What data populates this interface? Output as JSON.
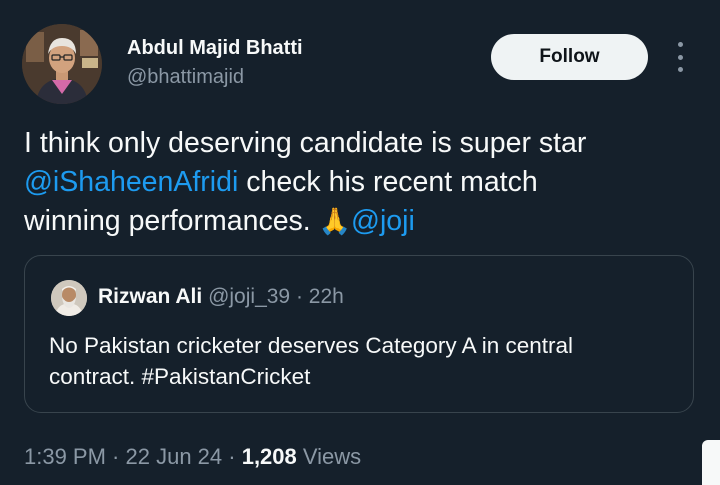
{
  "author": {
    "name": "Abdul Majid Bhatti",
    "handle": "@bhattimajid",
    "avatar_icon": "profile-photo"
  },
  "follow_label": "Follow",
  "more_icon": "vertical-ellipsis-icon",
  "tweet": {
    "line1": "I think only deserving candidate is super star",
    "mention1": "@iShaheenAfridi",
    "line2_rest": " check his recent match",
    "line3": "winning performances. ",
    "emoji": "🙏",
    "mention2": "@joji"
  },
  "quote": {
    "name": "Rizwan Ali",
    "handle": "@joji_39",
    "separator": " · ",
    "time": "22h",
    "text_line1": "No Pakistan cricketer deserves Category A in central",
    "text_line2": "contract. #PakistanCricket"
  },
  "meta": {
    "time": "1:39 PM",
    "sep1": " · ",
    "date": "22 Jun 24",
    "sep2": " · ",
    "views_count": "1,208",
    "views_label": " Views"
  },
  "colors": {
    "background": "#15202b",
    "text": "#f7f9f9",
    "secondary": "#8b98a5",
    "link": "#1d9bf0",
    "border": "#38444d",
    "button_bg": "#eff3f4"
  }
}
